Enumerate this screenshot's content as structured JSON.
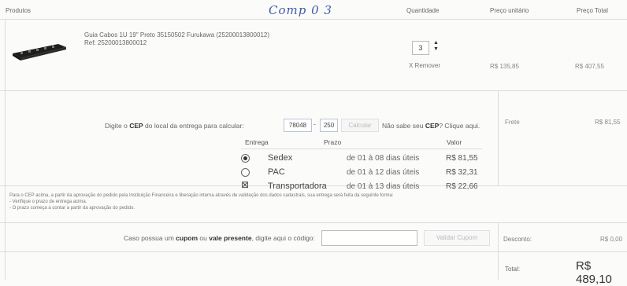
{
  "header": {
    "produtos": "Produtos",
    "quantidade": "Quantidade",
    "preco_unitario": "Preço unitário",
    "preco_total": "Preço Total",
    "handwritten": "Comp 0 3"
  },
  "product": {
    "name": "Guia Cabos 1U 19\" Preto 35150502 Furukawa (25200013800012)",
    "ref": "Ref: 25200013800012",
    "quantity": "3",
    "remove_label": "X Remover",
    "unit_price": "R$ 135,85",
    "total_price": "R$ 407,55"
  },
  "shipping_calc": {
    "label_prefix": "Digite o ",
    "label_bold": "CEP",
    "label_suffix": " do local da entrega para calcular:",
    "cep_part1": "78048",
    "cep_part2": "250",
    "calculate_button": "Calcular",
    "help_prefix": "Não sabe seu ",
    "help_bold": "CEP",
    "help_suffix": "? Clique aqui.",
    "frete_label": "Frete",
    "frete_value": "R$ 81,55"
  },
  "shipping_table": {
    "headers": {
      "entrega": "Entrega",
      "prazo": "Prazo",
      "valor": "Valor"
    },
    "options": [
      {
        "name": "Sedex",
        "prazo": "de 01 à 08 dias úteis",
        "valor": "R$ 81,55",
        "state": "selected"
      },
      {
        "name": "PAC",
        "prazo": "de 01 à 12 dias úteis",
        "valor": "R$ 32,31",
        "state": "unselected"
      },
      {
        "name": "Transportadora",
        "prazo": "de 01 à 13 dias úteis",
        "valor": "R$ 22,66",
        "state": "handmarked"
      }
    ]
  },
  "notes": {
    "line1": "Para o CEP acima, a partir da aprovação do pedido pela Instituição Financeira e liberação interna através de validação dos dados cadastrais, sua entrega será feita da seguinte forma:",
    "line2": "- Verifique o prazo de entrega acima.",
    "line3": "- O prazo começa a contar a partir da aprovação do pedido."
  },
  "coupon": {
    "label_prefix": "Caso possua um ",
    "label_bold1": "cupom",
    "label_mid": " ou ",
    "label_bold2": "vale presente",
    "label_suffix": ", digite aqui o código:",
    "input_value": "",
    "button": "Validar Cupom",
    "discount_label": "Desconto:",
    "discount_value": "R$ 0,00"
  },
  "summary": {
    "total_label": "Total:",
    "total_value": "R$ 489,10"
  },
  "icons": {
    "product_image": "cable-guide-icon",
    "radio_selected": "radio-selected-icon",
    "radio_unselected": "radio-unselected-icon",
    "handmark": "handwritten-check-icon"
  }
}
